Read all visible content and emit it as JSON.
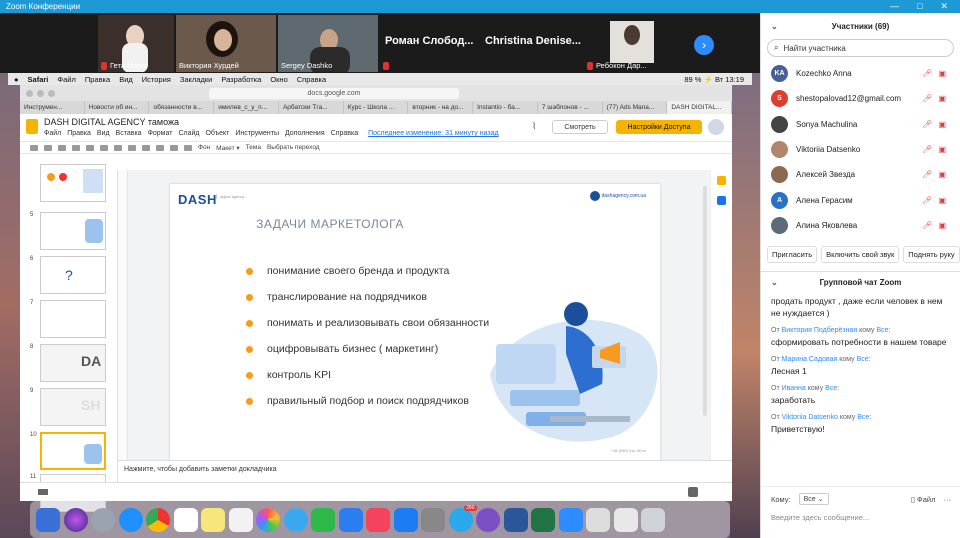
{
  "zoom": {
    "title": "Zoom Конференции",
    "controls": [
      "—",
      "□",
      "✕"
    ]
  },
  "video_tiles": [
    {
      "name": "Гета Марія"
    },
    {
      "name": "Виктория Хурдей"
    },
    {
      "name": "Sergey Dashko"
    },
    {
      "name": "Роман Слобод..."
    },
    {
      "name": "Christina Denise..."
    },
    {
      "name": "Ребокон Дар..."
    }
  ],
  "mac_menubar": {
    "items": [
      "",
      "Safari",
      "Файл",
      "Правка",
      "Вид",
      "История",
      "Закладки",
      "Разработка",
      "Окно",
      "Справка"
    ],
    "status": "89 % ⚡ Вт 13:19"
  },
  "safari": {
    "url": "docs.google.com",
    "tabs": [
      "Инструмен...",
      "Новости об ин...",
      "обязанности в...",
      "имилев_с_у_п...",
      "Арбатски Тга...",
      "Курс - Школа ...",
      "вторник - на до...",
      "Instantio - ба...",
      "7 шаблонов - ...",
      "(77) Ads Mana...",
      "DASH DIGITAL..."
    ]
  },
  "slides": {
    "doc_title": "DASH DIGITAL AGENCY таможа",
    "menu": [
      "Файл",
      "Правка",
      "Вид",
      "Вставка",
      "Формат",
      "Слайд",
      "Объект",
      "Инструменты",
      "Дополнения",
      "Справка"
    ],
    "last_edit": "Последнее изменение: 31 минуту назад",
    "present_label": "Смотреть",
    "share_label": "Настройки Доступа",
    "toolbar": [
      "Фон",
      "Макет ▾",
      "Тема",
      "Выбрать переход"
    ],
    "thumb_numbers": [
      "",
      "5",
      "6",
      "7",
      "8",
      "9",
      "10",
      "11"
    ],
    "thumb_texts": [
      "",
      "",
      "",
      "",
      "DA",
      "SH",
      "",
      ""
    ],
    "notes_placeholder": "Нажмите, чтобы добавить заметки докладчика"
  },
  "slide": {
    "logo": "DASH",
    "logo_sub": "digital agency",
    "badge": "dashagency.com.ua",
    "title": "ЗАДАЧИ МАРКЕТОЛОГА",
    "bullets": [
      "понимание своего бренда и продукта",
      "транслирование на подрядчиков",
      "понимать и реализовывать свои обязанности",
      "оцифровывать бизнес ( маркетинг)",
      "контроль KPI",
      "правильный подбор и поиск подрядчиков"
    ],
    "footer": "+38 (050) 0xx 38 xx"
  },
  "dock": {
    "badges": {
      "telegram": "280"
    }
  },
  "panel": {
    "title": "Участники (69)",
    "search_placeholder": "Найти участника",
    "participants": [
      {
        "initials": "KA",
        "name": "Kozechko Anna",
        "color": "#4a5f9a"
      },
      {
        "initials": "S",
        "name": "shestopalovad12@gmail.com",
        "color": "#d9402f"
      },
      {
        "initials": "",
        "name": "Sonya Machulina",
        "color": "#444444"
      },
      {
        "initials": "",
        "name": "Viktoriia Datsenko",
        "color": "#b0876c"
      },
      {
        "initials": "",
        "name": "Алексей Звезда",
        "color": "#8c6a52"
      },
      {
        "initials": "А",
        "name": "Алена Герасим",
        "color": "#2b72c6"
      },
      {
        "initials": "",
        "name": "Алина Яковлева",
        "color": "#5d6a78"
      }
    ],
    "buttons": [
      "Пригласить",
      "Включить свой звук",
      "Поднять руку"
    ],
    "chat_title": "Групповой чат Zoom",
    "messages": [
      {
        "from": "",
        "to": "",
        "text": "продать продукт , даже если человек в нем не нуждается )"
      },
      {
        "from": "Виктория Подберёзная",
        "to": "Все",
        "text": "сформировать потребности в нашем товаре"
      },
      {
        "from": "Марина Садовая",
        "to": "Все",
        "text": "Лесная 1"
      },
      {
        "from": "Иванна",
        "to": "Все",
        "text": "заработать"
      },
      {
        "from": "Viktoriia Datsenko",
        "to": "Все",
        "text": "Приветствую!"
      }
    ],
    "from_label": "От",
    "to_label": "кому",
    "to_prefix": "Кому:",
    "to_value": "Все",
    "file_label": "Файл",
    "input_placeholder": "Введите здесь сообщение..."
  }
}
